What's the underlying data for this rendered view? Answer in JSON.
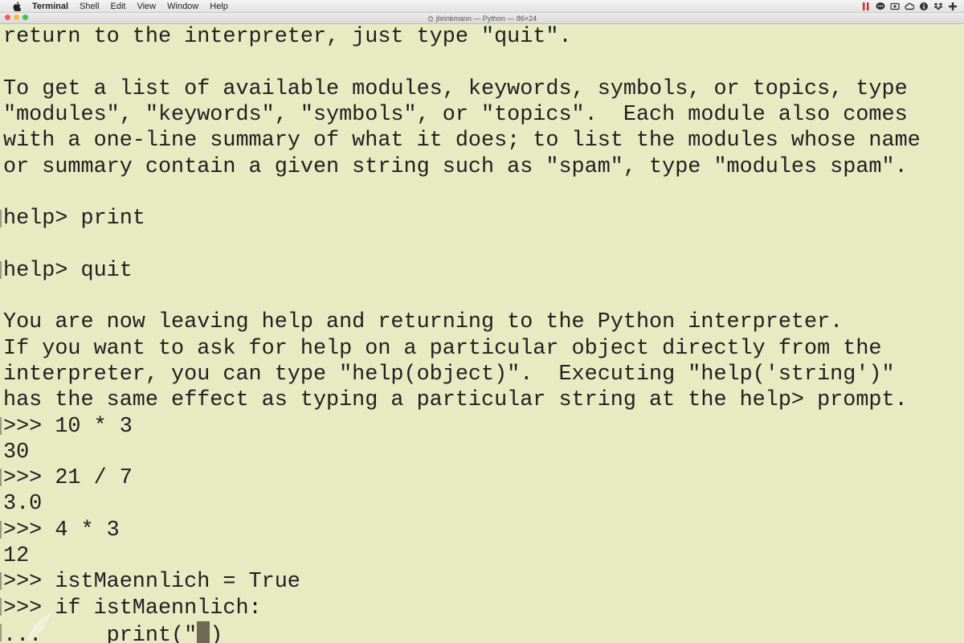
{
  "menubar": {
    "app_name": "Terminal",
    "items": [
      "Shell",
      "Edit",
      "View",
      "Window",
      "Help"
    ]
  },
  "window": {
    "title": "jbrinkmann — Python — 86×24"
  },
  "colors": {
    "background": "#e6ebc2",
    "text": "#1f1f1f",
    "cursor": "#6f6a52",
    "close": "#f25f58",
    "minimize": "#f9be3d",
    "zoom": "#3dc449"
  },
  "status_icons": [
    "pause-icon",
    "chat-icon",
    "screen-record-icon",
    "creative-cloud-icon",
    "info-icon",
    "dropbox-icon",
    "plus-icon"
  ],
  "terminal": {
    "lines": [
      "return to the interpreter, just type \"quit\".",
      "",
      "To get a list of available modules, keywords, symbols, or topics, type",
      "\"modules\", \"keywords\", \"symbols\", or \"topics\".  Each module also comes",
      "with a one-line summary of what it does; to list the modules whose name",
      "or summary contain a given string such as \"spam\", type \"modules spam\".",
      "",
      "help> print",
      "",
      "help> quit",
      "",
      "You are now leaving help and returning to the Python interpreter.",
      "If you want to ask for help on a particular object directly from the",
      "interpreter, you can type \"help(object)\".  Executing \"help('string')\"",
      "has the same effect as typing a particular string at the help> prompt.",
      ">>> 10 * 3",
      "30",
      ">>> 21 / 7",
      "3.0",
      ">>> 4 * 3",
      "12",
      ">>> istMaennlich = True",
      ">>> if istMaennlich:",
      "...     print(\""
    ],
    "cursor_line_suffix": ")"
  }
}
